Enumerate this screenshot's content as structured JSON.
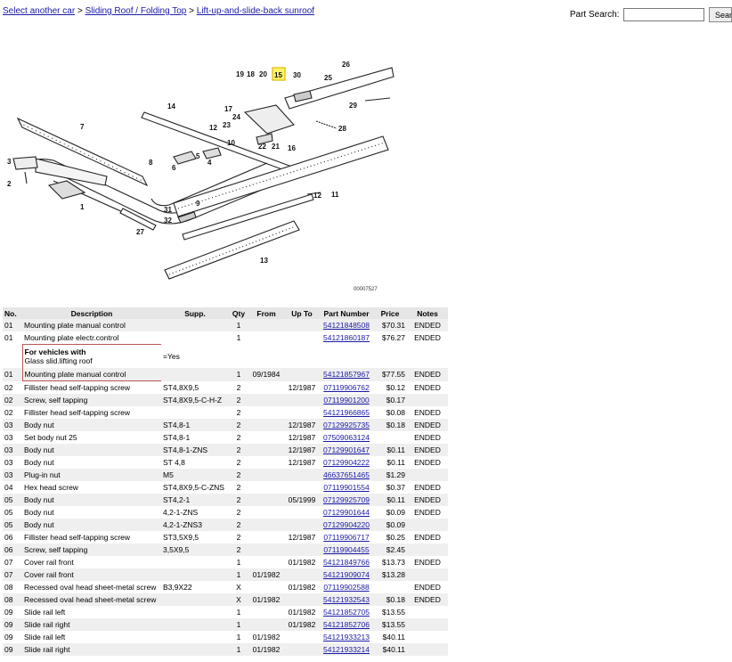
{
  "breadcrumb": {
    "items": [
      "Select another car",
      "Sliding Roof / Folding Top",
      "Lift-up-and-slide-back sunroof"
    ],
    "separator": ">"
  },
  "search": {
    "label": "Part Search:",
    "value": "",
    "button_label": "Search"
  },
  "diagram": {
    "code": "00007527",
    "highlighted_callout": "15",
    "callouts": [
      "1",
      "2",
      "3",
      "4",
      "5",
      "6",
      "7",
      "8",
      "9",
      "10",
      "11",
      "12",
      "12",
      "13",
      "14",
      "15",
      "16",
      "17",
      "18",
      "19",
      "20",
      "21",
      "22",
      "23",
      "24",
      "25",
      "26",
      "27",
      "28",
      "29",
      "30",
      "31",
      "32"
    ]
  },
  "table": {
    "headers": [
      "No.",
      "Description",
      "Supp.",
      "Qty",
      "From",
      "Up To",
      "Part Number",
      "Price",
      "Notes"
    ],
    "rows": [
      {
        "no": "01",
        "desc": "Mounting plate manual control",
        "supp": "",
        "qty": "1",
        "from": "",
        "upto": "",
        "part": "54121848508",
        "price": "$70.31",
        "notes": "ENDED"
      },
      {
        "no": "01",
        "desc": "Mounting plate electr.control",
        "supp": "",
        "qty": "1",
        "from": "",
        "upto": "",
        "part": "54121860187",
        "price": "$76.27",
        "notes": "ENDED"
      },
      {
        "note": true,
        "title": "For vehicles with",
        "text": "Glass slid.lifting roof",
        "supp": "=Yes"
      },
      {
        "no": "01",
        "desc": "Mounting plate manual control",
        "supp": "",
        "qty": "1",
        "from": "09/1984",
        "upto": "",
        "part": "54121857967",
        "price": "$77.55",
        "notes": "ENDED"
      },
      {
        "no": "02",
        "desc": "Fillister head self-tapping screw",
        "supp": "ST4,8X9,5",
        "qty": "2",
        "from": "",
        "upto": "12/1987",
        "part": "07119906762",
        "price": "$0.12",
        "notes": "ENDED"
      },
      {
        "no": "02",
        "desc": "Screw, self tapping",
        "supp": "ST4,8X9,5-C-H-Z",
        "qty": "2",
        "from": "",
        "upto": "",
        "part": "07119901200",
        "price": "$0.17",
        "notes": ""
      },
      {
        "no": "02",
        "desc": "Fillister head self-tapping screw",
        "supp": "",
        "qty": "2",
        "from": "",
        "upto": "",
        "part": "54121966865",
        "price": "$0.08",
        "notes": "ENDED"
      },
      {
        "no": "03",
        "desc": "Body nut",
        "supp": "ST4,8-1",
        "qty": "2",
        "from": "",
        "upto": "12/1987",
        "part": "07129925735",
        "price": "$0.18",
        "notes": "ENDED"
      },
      {
        "no": "03",
        "desc": "Set body nut 25",
        "supp": "ST4,8-1",
        "qty": "2",
        "from": "",
        "upto": "12/1987",
        "part": "07509063124",
        "price": "",
        "notes": "ENDED"
      },
      {
        "no": "03",
        "desc": "Body nut",
        "supp": "ST4,8-1-ZNS",
        "qty": "2",
        "from": "",
        "upto": "12/1987",
        "part": "07129901647",
        "price": "$0.11",
        "notes": "ENDED"
      },
      {
        "no": "03",
        "desc": "Body nut",
        "supp": "ST 4,8",
        "qty": "2",
        "from": "",
        "upto": "12/1987",
        "part": "07129904222",
        "price": "$0.11",
        "notes": "ENDED"
      },
      {
        "no": "03",
        "desc": "Plug-in nut",
        "supp": "M5",
        "qty": "2",
        "from": "",
        "upto": "",
        "part": "46637651465",
        "price": "$1.29",
        "notes": ""
      },
      {
        "no": "04",
        "desc": "Hex head screw",
        "supp": "ST4,8X9,5-C-ZNS",
        "qty": "2",
        "from": "",
        "upto": "",
        "part": "07119901554",
        "price": "$0.37",
        "notes": "ENDED"
      },
      {
        "no": "05",
        "desc": "Body nut",
        "supp": "ST4,2-1",
        "qty": "2",
        "from": "",
        "upto": "05/1999",
        "part": "07129925709",
        "price": "$0.11",
        "notes": "ENDED"
      },
      {
        "no": "05",
        "desc": "Body nut",
        "supp": "4,2-1-ZNS",
        "qty": "2",
        "from": "",
        "upto": "",
        "part": "07129901644",
        "price": "$0.09",
        "notes": "ENDED"
      },
      {
        "no": "05",
        "desc": "Body nut",
        "supp": "4,2-1-ZNS3",
        "qty": "2",
        "from": "",
        "upto": "",
        "part": "07129904220",
        "price": "$0.09",
        "notes": ""
      },
      {
        "no": "06",
        "desc": "Fillister head self-tapping screw",
        "supp": "ST3,5X9,5",
        "qty": "2",
        "from": "",
        "upto": "12/1987",
        "part": "07119906717",
        "price": "$0.25",
        "notes": "ENDED"
      },
      {
        "no": "06",
        "desc": "Screw, self tapping",
        "supp": "3,5X9,5",
        "qty": "2",
        "from": "",
        "upto": "",
        "part": "07119904455",
        "price": "$2.45",
        "notes": ""
      },
      {
        "no": "07",
        "desc": "Cover rail front",
        "supp": "",
        "qty": "1",
        "from": "",
        "upto": "01/1982",
        "part": "54121849766",
        "price": "$13.73",
        "notes": "ENDED"
      },
      {
        "no": "07",
        "desc": "Cover rail front",
        "supp": "",
        "qty": "1",
        "from": "01/1982",
        "upto": "",
        "part": "54121909074",
        "price": "$13.28",
        "notes": ""
      },
      {
        "no": "08",
        "desc": "Recessed oval head sheet-metal screw",
        "supp": "B3,9X22",
        "qty": "X",
        "from": "",
        "upto": "01/1982",
        "part": "07119902588",
        "price": "",
        "notes": "ENDED"
      },
      {
        "no": "08",
        "desc": "Recessed oval head sheet-metal screw",
        "supp": "",
        "qty": "X",
        "from": "01/1982",
        "upto": "",
        "part": "54121932543",
        "price": "$0.18",
        "notes": "ENDED"
      },
      {
        "no": "09",
        "desc": "Slide rail left",
        "supp": "",
        "qty": "1",
        "from": "",
        "upto": "01/1982",
        "part": "54121852705",
        "price": "$13.55",
        "notes": ""
      },
      {
        "no": "09",
        "desc": "Slide rail right",
        "supp": "",
        "qty": "1",
        "from": "",
        "upto": "01/1982",
        "part": "54121852706",
        "price": "$13.55",
        "notes": ""
      },
      {
        "no": "09",
        "desc": "Slide rail left",
        "supp": "",
        "qty": "1",
        "from": "01/1982",
        "upto": "",
        "part": "54121933213",
        "price": "$40.11",
        "notes": ""
      },
      {
        "no": "09",
        "desc": "Slide rail right",
        "supp": "",
        "qty": "1",
        "from": "01/1982",
        "upto": "",
        "part": "54121933214",
        "price": "$40.11",
        "notes": ""
      }
    ]
  }
}
